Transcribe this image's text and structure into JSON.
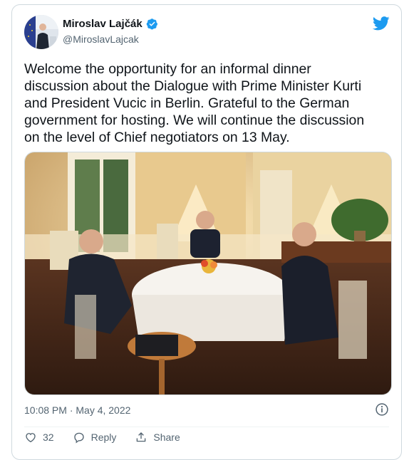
{
  "author": {
    "display_name": "Miroslav Lajčák",
    "handle": "@MiroslavLajcak",
    "verified": true
  },
  "tweet": {
    "text": "Welcome the opportunity for an informal dinner\ndiscussion about the Dialogue with Prime Minister Kurti\nand President Vucic in Berlin. Grateful to the German\ngovernment for hosting. We will continue the discussion\non the level of Chief negotiators on 13 May.",
    "timestamp": "10:08 PM · May 4, 2022"
  },
  "actions": {
    "like_count": "32",
    "reply_label": "Reply",
    "share_label": "Share"
  },
  "icons": {
    "brand": "twitter-bird-icon",
    "verified": "verified-badge-icon",
    "info": "info-icon",
    "like": "heart-icon",
    "reply": "reply-bubble-icon",
    "share": "share-icon"
  },
  "colors": {
    "brand_blue": "#1d9bf0",
    "text_primary": "#0f1419",
    "text_secondary": "#536471",
    "border": "#cfd9de"
  }
}
